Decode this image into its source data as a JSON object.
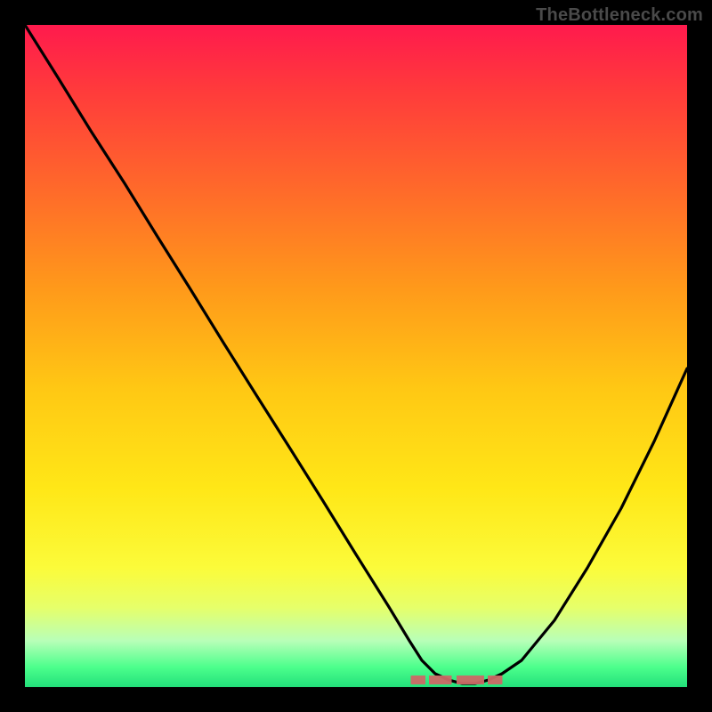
{
  "watermark": "TheBottleneck.com",
  "colors": {
    "curve_stroke": "#000000",
    "marker": "#cc6a66",
    "frame": "#000000"
  },
  "chart_data": {
    "type": "line",
    "title": "",
    "xlabel": "",
    "ylabel": "",
    "xlim": [
      0,
      100
    ],
    "ylim": [
      0,
      100
    ],
    "grid": false,
    "legend": false,
    "series": [
      {
        "name": "bottleneck-curve",
        "x": [
          0,
          5,
          10,
          15,
          20,
          25,
          30,
          35,
          40,
          45,
          50,
          55,
          58,
          60,
          62,
          64,
          66,
          68,
          70,
          72,
          75,
          80,
          85,
          90,
          95,
          100
        ],
        "y": [
          100,
          92,
          84,
          76,
          68,
          60,
          52,
          44,
          36,
          28,
          20,
          12,
          7,
          4,
          2,
          1,
          0.5,
          0.5,
          1,
          2,
          4,
          10,
          18,
          27,
          37,
          48
        ]
      }
    ],
    "markers": {
      "name": "optimal-range",
      "x_start": 58,
      "x_end": 72,
      "y": 0.5
    },
    "notes": "V-shaped bottleneck curve over a red→yellow→green vertical gradient; background black frame; no axis ticks or labels visible."
  }
}
